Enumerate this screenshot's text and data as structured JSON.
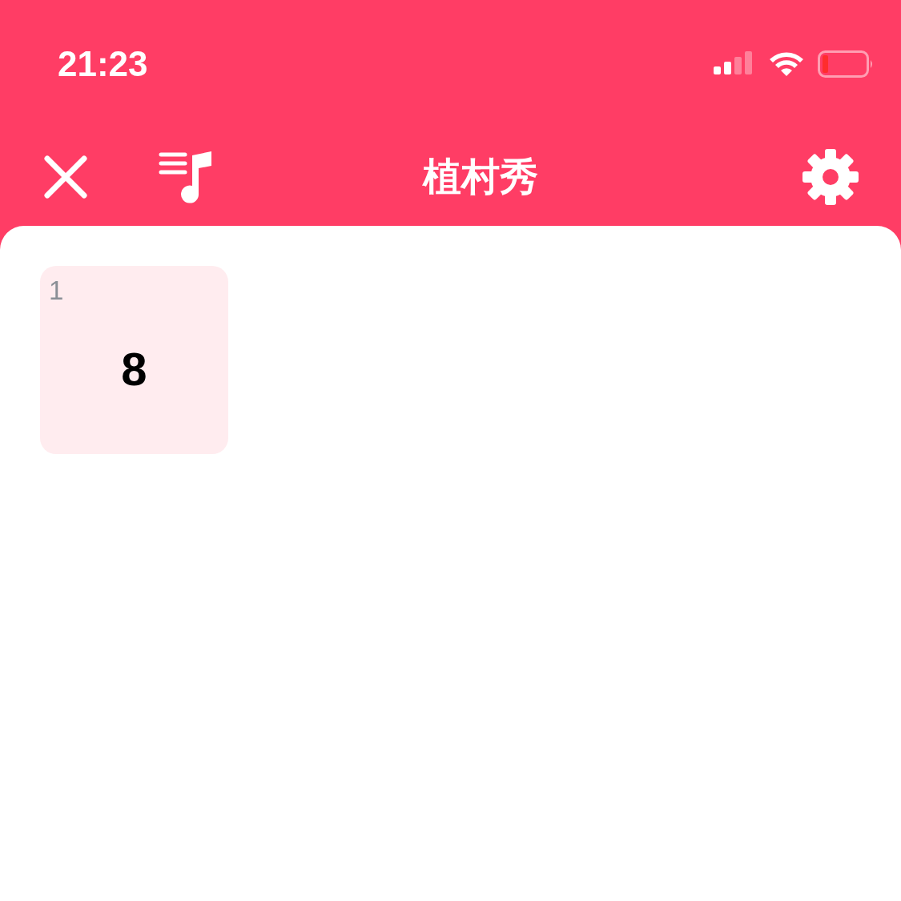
{
  "status_bar": {
    "time": "21:23"
  },
  "nav_bar": {
    "title": "植村秀"
  },
  "cards": [
    {
      "index": "1",
      "value": "8"
    }
  ]
}
